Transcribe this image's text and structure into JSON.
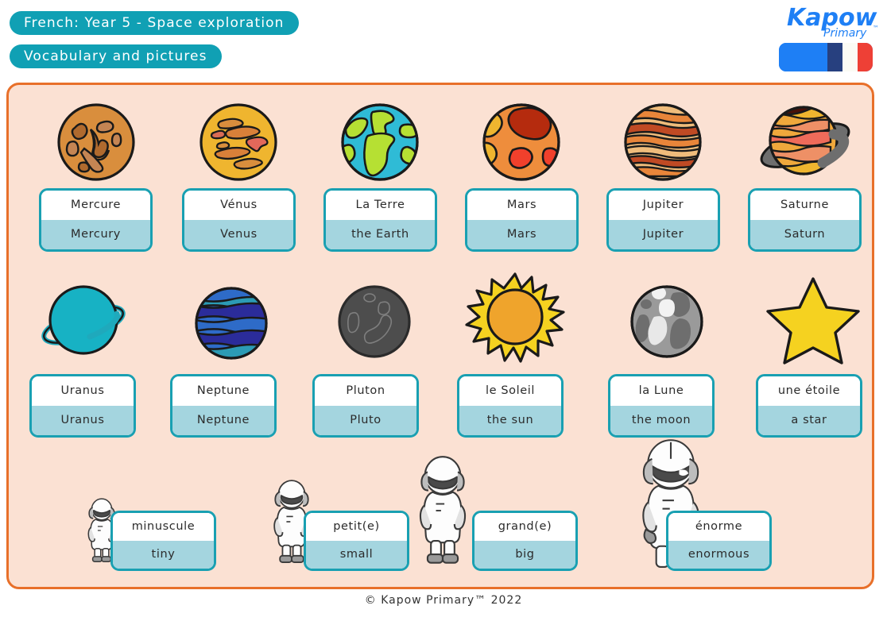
{
  "header": {
    "title": "French: Year 5 - Space exploration",
    "subtitle": "Vocabulary and pictures",
    "logo_name": "Kapow",
    "logo_sub": "Primary",
    "logo_tm": "™",
    "flag": "french-flag"
  },
  "colors": {
    "teal": "#19A0B2",
    "light_blue": "#A4D5DF",
    "panel_bg": "#FBE1D3",
    "panel_border": "#E8702A",
    "logo_blue": "#1E7FF5",
    "flag_blue": "#27407F",
    "flag_white": "#FBFBF5",
    "flag_red": "#EE4036"
  },
  "rows": {
    "planets_row1": [
      {
        "art": "mercury-planet",
        "fr": "Mercure",
        "en": "Mercury"
      },
      {
        "art": "venus-planet",
        "fr": "Vénus",
        "en": "Venus"
      },
      {
        "art": "earth-planet",
        "fr": "La Terre",
        "en": "the Earth"
      },
      {
        "art": "mars-planet",
        "fr": "Mars",
        "en": "Mars"
      },
      {
        "art": "jupiter-planet",
        "fr": "Jupiter",
        "en": "Jupiter"
      },
      {
        "art": "saturn-planet",
        "fr": "Saturne",
        "en": "Saturn"
      }
    ],
    "planets_row2": [
      {
        "art": "uranus-planet",
        "fr": "Uranus",
        "en": "Uranus"
      },
      {
        "art": "neptune-planet",
        "fr": "Neptune",
        "en": "Neptune"
      },
      {
        "art": "pluto-planet",
        "fr": "Pluton",
        "en": "Pluto"
      },
      {
        "art": "sun",
        "fr": "le Soleil",
        "en": "the sun"
      },
      {
        "art": "moon",
        "fr": "la Lune",
        "en": "the moon"
      },
      {
        "art": "star",
        "fr": "une étoile",
        "en": "a star"
      }
    ],
    "adjectives": [
      {
        "art": "astronaut-tiny",
        "fr": "minuscule",
        "en": "tiny"
      },
      {
        "art": "astronaut-small",
        "fr": "petit(e)",
        "en": "small"
      },
      {
        "art": "astronaut-big",
        "fr": "grand(e)",
        "en": "big"
      },
      {
        "art": "astronaut-enormous",
        "fr": "énorme",
        "en": "enormous"
      }
    ]
  },
  "footer": {
    "copyright": "© Kapow Primary™ 2022"
  }
}
